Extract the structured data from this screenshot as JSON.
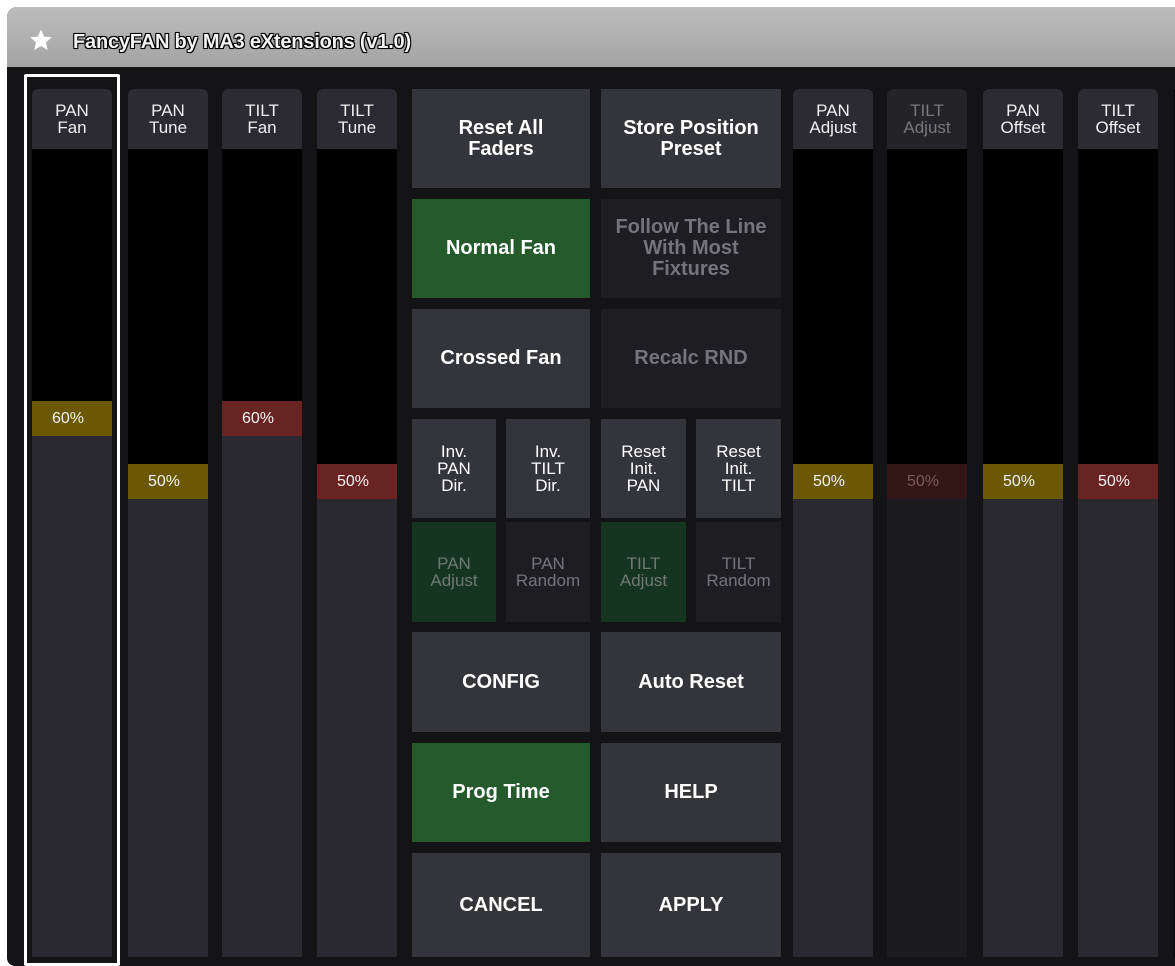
{
  "window": {
    "title": "FancyFAN by MA3 eXtensions (v1.0)",
    "icon": "star-icon"
  },
  "colors": {
    "yellow_knob": "#6a5805",
    "red_knob": "#6a2323",
    "green_button": "#255a2d",
    "button": "#34343b"
  },
  "faders": [
    {
      "line1": "PAN",
      "line2": "Fan",
      "value": "60%",
      "level": 0.6,
      "color": "yellow"
    },
    {
      "line1": "PAN",
      "line2": "Tune",
      "value": "50%",
      "level": 0.5,
      "color": "yellow"
    },
    {
      "line1": "TILT",
      "line2": "Fan",
      "value": "60%",
      "level": 0.6,
      "color": "red"
    },
    {
      "line1": "TILT",
      "line2": "Tune",
      "value": "50%",
      "level": 0.5,
      "color": "red"
    },
    {
      "line1": "PAN",
      "line2": "Adjust",
      "value": "50%",
      "level": 0.5,
      "color": "yellow"
    },
    {
      "line1": "TILT",
      "line2": "Adjust",
      "value": "50%",
      "level": 0.5,
      "color": "red",
      "disabled": true
    },
    {
      "line1": "PAN",
      "line2": "Offset",
      "value": "50%",
      "level": 0.5,
      "color": "yellow"
    },
    {
      "line1": "TILT",
      "line2": "Offset",
      "value": "50%",
      "level": 0.5,
      "color": "red"
    }
  ],
  "buttons": {
    "reset_all": {
      "line1": "Reset All",
      "line2": "Faders"
    },
    "store_pos": {
      "line1": "Store Position",
      "line2": "Preset"
    },
    "normal_fan": "Normal Fan",
    "follow_line": {
      "line1": "Follow The Line",
      "line2": "With Most",
      "line3": "Fixtures"
    },
    "crossed_fan": "Crossed Fan",
    "recalc_rnd": "Recalc RND",
    "inv_pan": {
      "line1": "Inv.",
      "line2": "PAN",
      "line3": "Dir."
    },
    "inv_tilt": {
      "line1": "Inv.",
      "line2": "TILT",
      "line3": "Dir."
    },
    "reset_init_pan": {
      "line1": "Reset",
      "line2": "Init.",
      "line3": "PAN"
    },
    "reset_init_tilt": {
      "line1": "Reset",
      "line2": "Init.",
      "line3": "TILT"
    },
    "pan_adjust": {
      "line1": "PAN",
      "line2": "Adjust"
    },
    "pan_random": {
      "line1": "PAN",
      "line2": "Random"
    },
    "tilt_adjust": {
      "line1": "TILT",
      "line2": "Adjust"
    },
    "tilt_random": {
      "line1": "TILT",
      "line2": "Random"
    },
    "config": "CONFIG",
    "auto_reset": "Auto Reset",
    "prog_time": "Prog Time",
    "help": "HELP",
    "cancel": "CANCEL",
    "apply": "APPLY"
  }
}
